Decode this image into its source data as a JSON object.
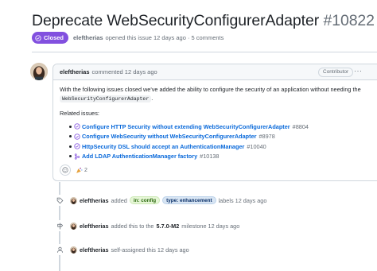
{
  "issue": {
    "title": "Deprecate WebSecurityConfigurerAdapter",
    "number": "#10822",
    "status_label": "Closed",
    "author": "eleftherias",
    "opened_text": "opened this issue 12 days ago · 5 comments"
  },
  "comment": {
    "author": "eleftherias",
    "time_text": "commented 12 days ago",
    "contributor_badge": "Contributor",
    "menu": "···",
    "body_text": "With the following issues closed we've added the ability to configure the security of an application without needing the",
    "code": "WebSecurityConfigurerAdapter",
    "code_suffix": ".",
    "related_heading": "Related issues:",
    "related_issues": [
      {
        "title": "Configure HTTP Security without extending WebSecurityConfigurerAdapter",
        "ref": "#8804",
        "icon": "closed-issue-icon"
      },
      {
        "title": "Configure WebSecurity without WebSecurityConfigurerAdapter",
        "ref": "#8978",
        "icon": "closed-issue-icon"
      },
      {
        "title": "HttpSecurity DSL should accept an AuthenticationManager",
        "ref": "#10040",
        "icon": "closed-issue-icon"
      },
      {
        "title": "Add LDAP AuthenticationManager factory",
        "ref": "#10138",
        "icon": "merged-pr-icon"
      }
    ],
    "reaction_count": "2"
  },
  "timeline": {
    "labels_event": {
      "author": "eleftherias",
      "action": "added",
      "label1": "in: config",
      "label2": "type: enhancement",
      "suffix": "labels 12 days ago"
    },
    "milestone_event": {
      "author": "eleftherias",
      "action": "added this to the",
      "milestone": "5.7.0-M2",
      "suffix": "milestone 12 days ago"
    },
    "assign_event": {
      "author": "eleftherias",
      "action": "self-assigned this 12 days ago"
    }
  },
  "colors": {
    "closed_purple": "#8250df",
    "link_blue": "#0969da",
    "muted": "#656d76",
    "border": "#d0d7de"
  }
}
